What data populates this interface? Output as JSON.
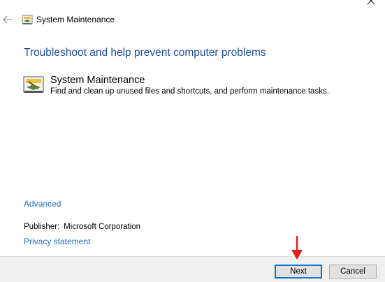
{
  "window": {
    "title": "System Maintenance"
  },
  "main": {
    "heading": "Troubleshoot and help prevent computer problems",
    "item": {
      "title": "System Maintenance",
      "description": "Find and clean up unused files and shortcuts, and perform maintenance tasks."
    },
    "advanced_link": "Advanced",
    "publisher_label": "Publisher:",
    "publisher_value": "Microsoft Corporation",
    "privacy_link": "Privacy statement"
  },
  "footer": {
    "next_label": "Next",
    "cancel_label": "Cancel"
  },
  "icons": {
    "close": "close-icon",
    "back": "back-arrow-icon",
    "title": "troubleshooter-icon",
    "item": "system-maintenance-icon",
    "annotation": "red-arrow-icon"
  },
  "colors": {
    "heading": "#1f4e9e",
    "link": "#1f6ec9",
    "annotation_arrow": "#e02020",
    "footer_bg": "#f0f0f0",
    "default_button_border": "#0078d7"
  }
}
